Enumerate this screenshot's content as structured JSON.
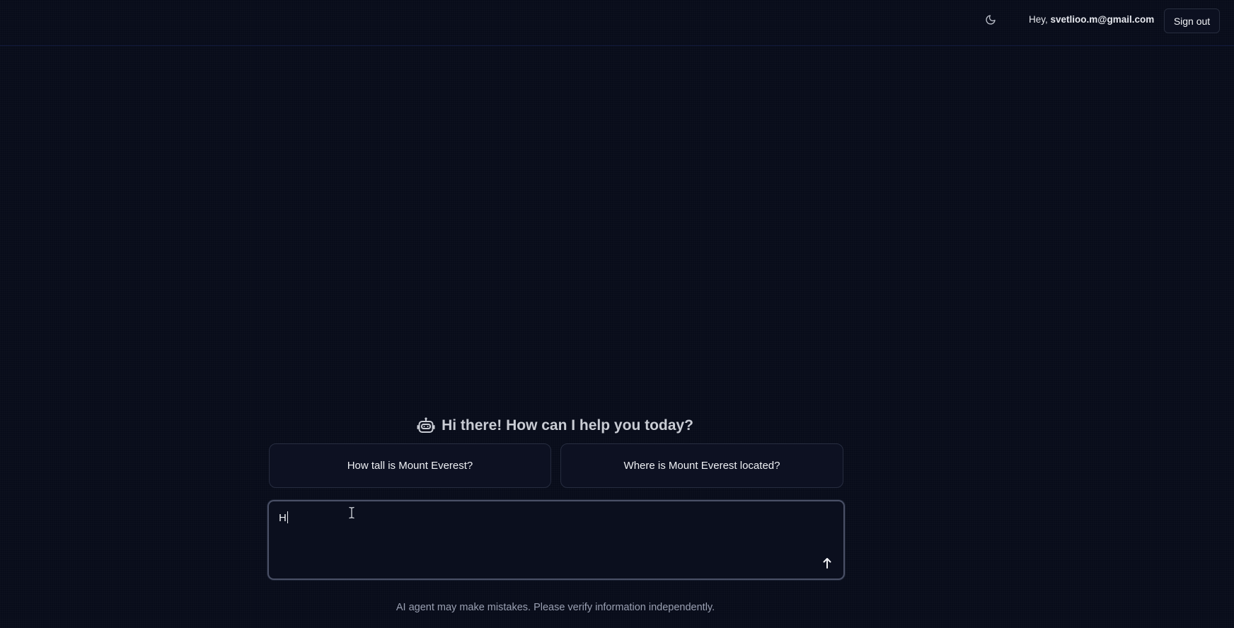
{
  "header": {
    "theme_toggle_icon": "moon-icon",
    "greeting_prefix": "Hey, ",
    "user_email": "svetlioo.m@gmail.com",
    "signout_label": "Sign out"
  },
  "welcome": {
    "icon": "robot-icon",
    "text": "Hi there! How can I help you today?"
  },
  "suggestions": [
    {
      "label": "How tall is Mount Everest?"
    },
    {
      "label": "Where is Mount Everest located?"
    }
  ],
  "composer": {
    "value": "H",
    "send_icon": "arrow-up-icon"
  },
  "footer": {
    "disclaimer": "AI agent may make mistakes. Please verify information independently."
  },
  "colors": {
    "background": "#080c1a",
    "header_border": "#121a3d",
    "card_border": "#272d40",
    "input_border": "#4a5066",
    "muted_text": "#9aa0b2"
  }
}
